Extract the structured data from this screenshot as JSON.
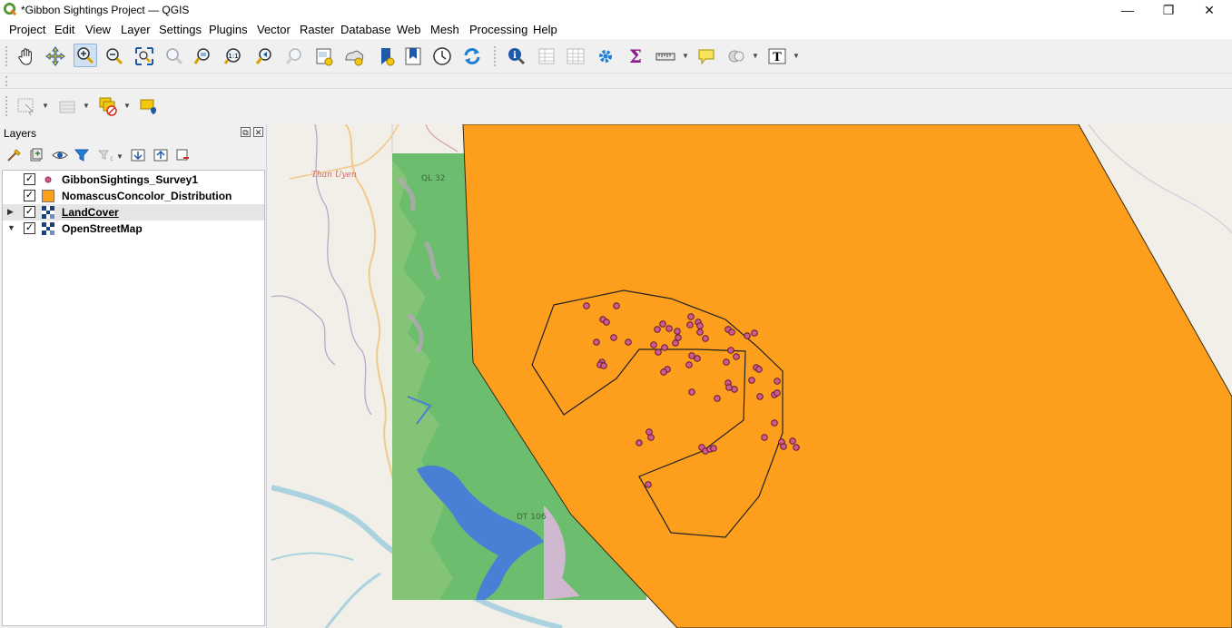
{
  "window": {
    "title": "*Gibbon Sightings Project — QGIS",
    "minimize": "—",
    "maximize": "❐",
    "close": "✕"
  },
  "menu": [
    "Project",
    "Edit",
    "View",
    "Layer",
    "Settings",
    "Plugins",
    "Vector",
    "Raster",
    "Database",
    "Web",
    "Mesh",
    "Processing",
    "Help"
  ],
  "toolbar1_icons": [
    "pan-icon",
    "pan-to-selection-icon",
    "zoom-in-icon",
    "zoom-out-icon",
    "zoom-full-icon",
    "zoom-to-selection-icon",
    "zoom-to-layer-icon",
    "zoom-native-resolution-icon",
    "zoom-last-icon",
    "zoom-next-icon",
    "new-bookmark-icon",
    "show-bookmarks-icon",
    "new-map-view-icon",
    "new-3d-view-icon",
    "temporal-controller-icon",
    "refresh-icon",
    "identify-icon",
    "open-attribute-table-icon",
    "open-field-calculator-icon",
    "toolbox-icon",
    "statistics-icon",
    "measure-icon",
    "map-tips-icon",
    "select-by-location-icon",
    "text-annotation-icon"
  ],
  "toolbar2_icons": [
    "select-features-icon",
    "deselect-icon",
    "select-by-expression-icon",
    "deselect-all-icon"
  ],
  "layers_panel": {
    "title": "Layers",
    "tools": [
      "open-layer-styling-icon",
      "add-group-icon",
      "manage-visibility-icon",
      "filter-legend-icon",
      "filter-by-expression-icon",
      "expand-all-icon",
      "collapse-all-icon",
      "remove-layer-icon"
    ],
    "layers": [
      {
        "name": "GibbonSightings_Survey1",
        "checked": true,
        "icon": "point-symbol-icon",
        "expander": "",
        "selected": false,
        "underline": false
      },
      {
        "name": "NomascusConcolor_Distribution",
        "checked": true,
        "icon": "polygon-symbol-icon",
        "expander": "",
        "selected": false,
        "underline": false
      },
      {
        "name": "LandCover",
        "checked": true,
        "icon": "raster-icon",
        "expander": "▶",
        "selected": true,
        "underline": true
      },
      {
        "name": "OpenStreetMap",
        "checked": true,
        "icon": "raster-icon",
        "expander": "▼",
        "selected": false,
        "underline": false
      }
    ]
  },
  "map": {
    "labels": [
      "Than Uyen",
      "QL 32",
      "DT 106"
    ],
    "colors": {
      "distribution_fill": "#fd9e1c",
      "landcover_green": "#6dbd6e",
      "water": "#4a7fd6",
      "sighting_point": "#d05a8a",
      "basemap": "#f2efe9"
    }
  }
}
